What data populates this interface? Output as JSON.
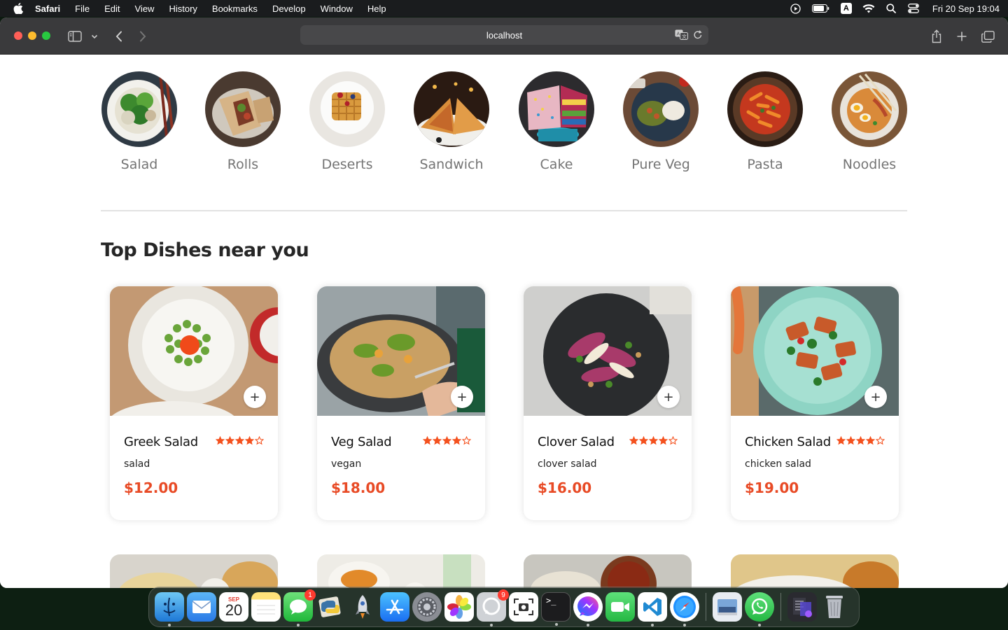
{
  "menubar": {
    "items": [
      "Safari",
      "File",
      "Edit",
      "View",
      "History",
      "Bookmarks",
      "Develop",
      "Window",
      "Help"
    ],
    "input_indicator": "A",
    "clock": "Fri 20 Sep  19:04"
  },
  "browser": {
    "url": "localhost"
  },
  "categories": [
    {
      "label": "Salad"
    },
    {
      "label": "Rolls"
    },
    {
      "label": "Deserts"
    },
    {
      "label": "Sandwich"
    },
    {
      "label": "Cake"
    },
    {
      "label": "Pure Veg"
    },
    {
      "label": "Pasta"
    },
    {
      "label": "Noodles"
    }
  ],
  "section": {
    "title": "Top Dishes near you"
  },
  "dishes": [
    {
      "name": "Greek Salad",
      "description": "salad",
      "price": "$12.00",
      "rating": 4,
      "add_label": "+"
    },
    {
      "name": "Veg Salad",
      "description": "vegan",
      "price": "$18.00",
      "rating": 4,
      "add_label": "+"
    },
    {
      "name": "Clover Salad",
      "description": "clover salad",
      "price": "$16.00",
      "rating": 4,
      "add_label": "+"
    },
    {
      "name": "Chicken Salad",
      "description": "chicken salad",
      "price": "$19.00",
      "rating": 4,
      "add_label": "+"
    }
  ],
  "dock": {
    "calendar_month": "SEP",
    "calendar_day": "20",
    "messages_badge": "1",
    "whatsapp_badge": "9"
  },
  "colors": {
    "accent": "#e84a25",
    "star": "#f4511e"
  }
}
